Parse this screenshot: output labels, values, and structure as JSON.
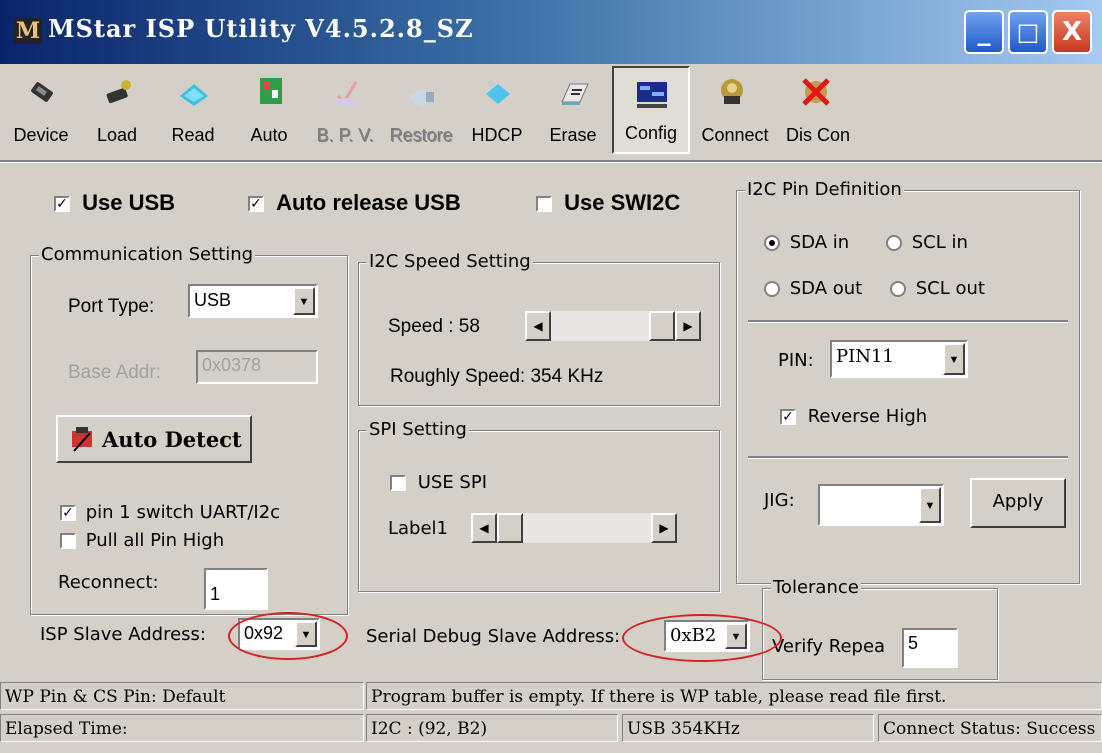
{
  "window": {
    "title": "MStar ISP Utility V4.5.2.8_SZ",
    "logo_text": "M",
    "minimize": "_",
    "maximize": "□",
    "close": "X"
  },
  "toolbar": [
    {
      "label": "Device",
      "icon": "device-icon",
      "state": "normal"
    },
    {
      "label": "Load",
      "icon": "load-icon",
      "state": "normal"
    },
    {
      "label": "Read",
      "icon": "read-icon",
      "state": "normal"
    },
    {
      "label": "Auto",
      "icon": "auto-icon",
      "state": "normal"
    },
    {
      "label": "B. P. V.",
      "icon": "bpv-icon",
      "state": "disabled"
    },
    {
      "label": "Restore",
      "icon": "restore-icon",
      "state": "disabled"
    },
    {
      "label": "HDCP",
      "icon": "hdcp-icon",
      "state": "normal"
    },
    {
      "label": "Erase",
      "icon": "erase-icon",
      "state": "normal"
    },
    {
      "label": "Config",
      "icon": "config-icon",
      "state": "pressed"
    },
    {
      "label": "Connect",
      "icon": "connect-icon",
      "state": "normal"
    },
    {
      "label": "Dis Con",
      "icon": "disconnect-icon",
      "state": "normal"
    }
  ],
  "options": {
    "use_usb": {
      "label": "Use USB",
      "checked": true
    },
    "auto_release_usb": {
      "label": "Auto release USB",
      "checked": true
    },
    "use_swi2c": {
      "label": "Use SWI2C",
      "checked": false
    }
  },
  "communication": {
    "title": "Communication Setting",
    "port_type_label": "Port Type:",
    "port_type_value": "USB",
    "base_addr_label": "Base Addr:",
    "base_addr_value": "0x0378",
    "auto_detect_label": "Auto Detect",
    "pin1_switch": {
      "label": "pin 1 switch UART/I2c",
      "checked": true
    },
    "pull_all_pin_high": {
      "label": "Pull all Pin High",
      "checked": false
    },
    "reconnect_label": "Reconnect:",
    "reconnect_value": "1"
  },
  "i2c_speed": {
    "title": "I2C Speed Setting",
    "speed_label": "Speed : 58",
    "speed_value": 58,
    "roughly_label": "Roughly Speed: 354 KHz"
  },
  "spi": {
    "title": "SPI Setting",
    "use_spi": {
      "label": "USE SPI",
      "checked": false
    },
    "label1": "Label1"
  },
  "i2c_pin": {
    "title": "I2C Pin Definition",
    "sda_in": {
      "label": "SDA in",
      "selected": true
    },
    "scl_in": {
      "label": "SCL in",
      "selected": false
    },
    "sda_out": {
      "label": "SDA out",
      "selected": false
    },
    "scl_out": {
      "label": "SCL out",
      "selected": false
    },
    "pin_label": "PIN:",
    "pin_value": "PIN11",
    "reverse_high": {
      "label": "Reverse High",
      "checked": true
    },
    "jig_label": "JIG:",
    "jig_value": "",
    "apply_label": "Apply"
  },
  "tolerance": {
    "title": "Tolerance",
    "verify_label": "Verify Repea",
    "verify_value": "5"
  },
  "addresses": {
    "isp_label": "ISP Slave Address:",
    "isp_value": "0x92",
    "serial_label": "Serial Debug Slave Address:",
    "serial_value": "0xB2"
  },
  "status": {
    "wp_pin": "WP Pin & CS Pin: Default",
    "message": "Program buffer is empty. If there is WP table, please read file first.",
    "elapsed": "Elapsed Time:",
    "i2c": "I2C :  (92, B2)",
    "usb": "USB   354KHz",
    "connect": "Connect Status: Success"
  },
  "colors": {
    "annotation": "#d62020",
    "face": "#d4d0c8",
    "title_dark": "#0a246a"
  }
}
